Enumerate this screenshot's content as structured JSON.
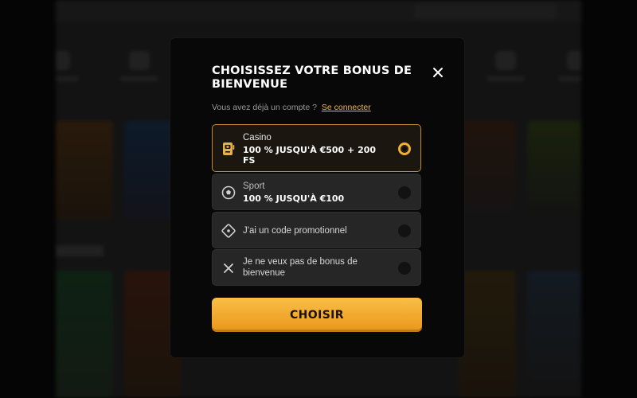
{
  "modal": {
    "title": "CHOISISSEZ VOTRE BONUS DE BIENVENUE",
    "login_prompt": "Vous avez déjà un compte ?",
    "login_link": "Se connecter",
    "close_icon": "close-icon"
  },
  "options": [
    {
      "label": "Casino",
      "value": "100 % JUSQU'À €500 + 200 FS",
      "icon": "slot-machine-icon",
      "selected": true
    },
    {
      "label": "Sport",
      "value": "100 % JUSQU'À €100",
      "icon": "soccer-ball-icon",
      "selected": false
    },
    {
      "label": "J'ai un code promotionnel",
      "icon": "promo-code-icon",
      "selected": false
    },
    {
      "label": "Je ne veux pas de bonus de bienvenue",
      "icon": "no-bonus-icon",
      "selected": false
    }
  ],
  "submit_label": "CHOISIR",
  "colors": {
    "accent": "#f2b02f",
    "button_gradient_top": "#f9bf47",
    "button_gradient_bottom": "#e9961a",
    "modal_bg": "#080808",
    "option_bg": "#262626"
  }
}
